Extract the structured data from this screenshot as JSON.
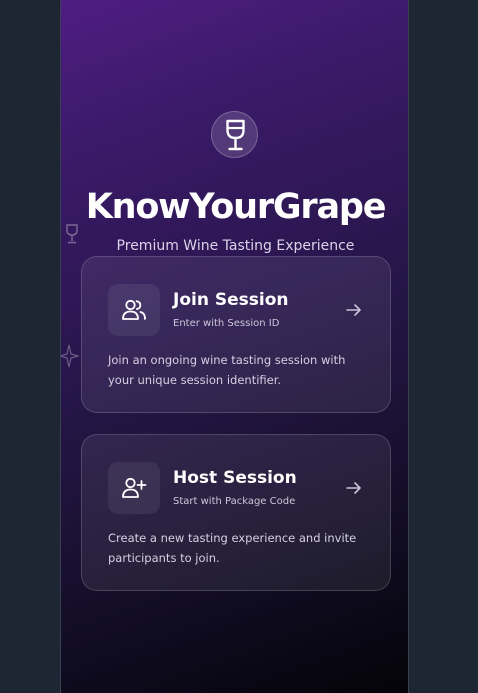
{
  "app": {
    "title": "KnowYourGrape",
    "subtitle": "Premium Wine Tasting Experience",
    "logo_icon": "wine-glass-icon"
  },
  "cards": {
    "join": {
      "icon": "users-icon",
      "title": "Join Session",
      "subtitle": "Enter with Session ID",
      "description": "Join an ongoing wine tasting session with your unique session identifier.",
      "arrow_icon": "arrow-right-icon"
    },
    "host": {
      "icon": "user-plus-icon",
      "title": "Host Session",
      "subtitle": "Start with Package Code",
      "description": "Create a new tasting experience and invite participants to join.",
      "arrow_icon": "arrow-right-icon"
    }
  },
  "colors": {
    "accent_purple": "#4f1d82",
    "page_background": "#1e2633",
    "text_primary": "#ffffff"
  }
}
